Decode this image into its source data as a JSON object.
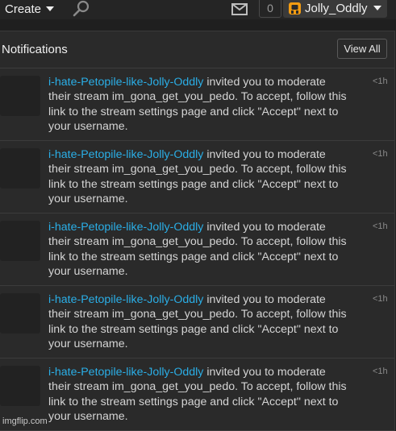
{
  "topbar": {
    "create_label": "Create",
    "search_icon": "search-icon",
    "mail_icon": "mail-icon",
    "points": "0",
    "username": "Jolly_Oddly"
  },
  "notifications": {
    "title": "Notifications",
    "view_all_label": "View All",
    "items": [
      {
        "user": "i-hate-Petopile-like-Jolly-Oddly",
        "message": " invited you to moderate their stream im_gona_get_you_pedo. To accept, follow this link to the stream settings page and click \"Accept\" next to your username.",
        "time": "<1h"
      },
      {
        "user": "i-hate-Petopile-like-Jolly-Oddly",
        "message": " invited you to moderate their stream im_gona_get_you_pedo. To accept, follow this link to the stream settings page and click \"Accept\" next to your username.",
        "time": "<1h"
      },
      {
        "user": "i-hate-Petopile-like-Jolly-Oddly",
        "message": " invited you to moderate their stream im_gona_get_you_pedo. To accept, follow this link to the stream settings page and click \"Accept\" next to your username.",
        "time": "<1h"
      },
      {
        "user": "i-hate-Petopile-like-Jolly-Oddly",
        "message": " invited you to moderate their stream im_gona_get_you_pedo. To accept, follow this link to the stream settings page and click \"Accept\" next to your username.",
        "time": "<1h"
      },
      {
        "user": "i-hate-Petopile-like-Jolly-Oddly",
        "message": " invited you to moderate their stream im_gona_get_you_pedo. To accept, follow this link to the stream settings page and click \"Accept\" next to your username.",
        "time": "<1h"
      }
    ]
  },
  "watermark": "imgflip.com",
  "colors": {
    "link": "#2aaee6",
    "avatar": "#f39c12"
  }
}
